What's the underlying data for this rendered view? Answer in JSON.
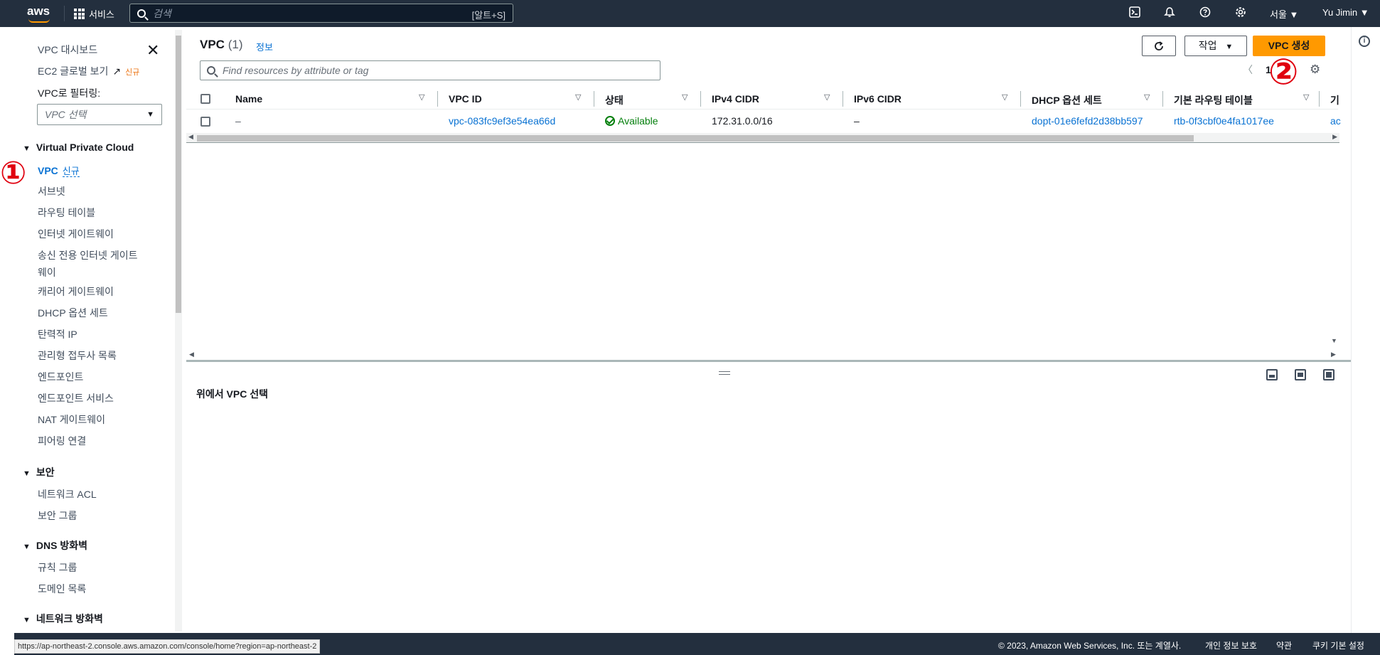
{
  "topnav": {
    "logo": "aws",
    "services_label": "서비스",
    "search_placeholder": "검색",
    "search_shortcut": "[알트+S]",
    "region": "서울 ▼",
    "user": "Yu Jimin ▼"
  },
  "sidebar": {
    "dashboard": "VPC 대시보드",
    "ec2_global": "EC2 글로벌 보기",
    "new_badge": "신규",
    "filter_label": "VPC로 필터링:",
    "filter_placeholder": "VPC 선택",
    "sections": {
      "vpc": "Virtual Private Cloud",
      "security": "보안",
      "dns_firewall": "DNS 방화벽",
      "network_firewall": "네트워크 방화벽"
    },
    "vpc_item": "VPC",
    "vpc_new": "신규",
    "items": [
      "서브넷",
      "라우팅 테이블",
      "인터넷 게이트웨이",
      "송신 전용 인터넷 게이트",
      "웨이",
      "캐리어 게이트웨이",
      "DHCP 옵션 세트",
      "탄력적 IP",
      "관리형 접두사 목록",
      "엔드포인트",
      "엔드포인트 서비스",
      "NAT 게이트웨이",
      "피어링 연결"
    ],
    "security_items": [
      "네트워크 ACL",
      "보안 그룹"
    ],
    "dns_items": [
      "규칙 그룹",
      "도메인 목록"
    ]
  },
  "panel": {
    "title": "VPC",
    "count": "(1)",
    "info": "정보",
    "actions_label": "작업",
    "create_label": "VPC 생성",
    "filter_placeholder": "Find resources by attribute or tag",
    "page": "1"
  },
  "table": {
    "columns": [
      "Name",
      "VPC ID",
      "상태",
      "IPv4 CIDR",
      "IPv6 CIDR",
      "DHCP 옵션 세트",
      "기본 라우팅 테이블",
      "기"
    ],
    "rows": [
      {
        "name": "–",
        "vpc_id": "vpc-083fc9ef3e54ea66d",
        "status": "Available",
        "ipv4": "172.31.0.0/16",
        "ipv6": "–",
        "dhcp": "dopt-01e6fefd2d38bb597",
        "route_table": "rtb-0f3cbf0e4fa1017ee",
        "extra": "ac"
      }
    ]
  },
  "details": {
    "empty_text": "위에서 VPC 선택"
  },
  "footer": {
    "copyright": "© 2023, Amazon Web Services, Inc. 또는 계열사.",
    "privacy": "개인 정보 보호",
    "terms": "약관",
    "cookies": "쿠키 기본 설정"
  },
  "status_url": "https://ap-northeast-2.console.aws.amazon.com/console/home?region=ap-northeast-2",
  "annotations": {
    "step1": "①",
    "step2": "②"
  },
  "colors": {
    "nav_bg": "#232f3e",
    "accent": "#ff9900",
    "link": "#0972d3",
    "success": "#037f0c",
    "annotation": "#e0000f"
  }
}
